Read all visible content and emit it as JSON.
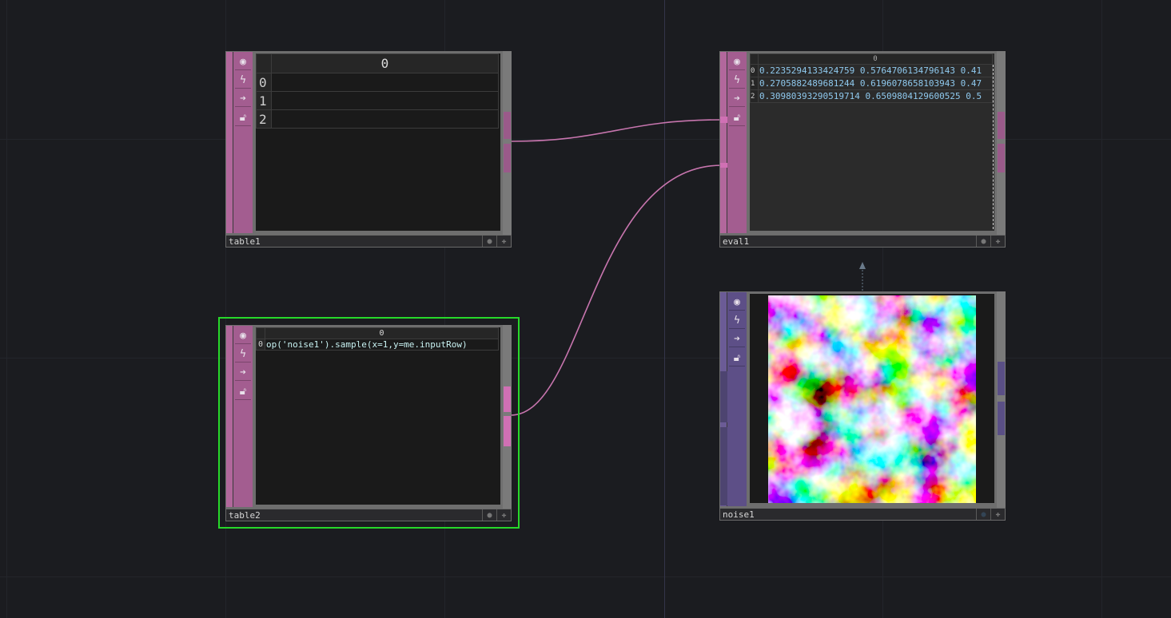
{
  "colors": {
    "background": "#1b1c20",
    "dat_accent": "#b2679c",
    "top_accent": "#6b5b96",
    "wire": "#c775ae",
    "selected_outline": "#27d82a"
  },
  "icons": [
    "viewer-toggle-icon",
    "cook-icon",
    "export-icon",
    "lock-icon",
    "bypass-flag-icon",
    "display-flag-icon"
  ],
  "nodes": {
    "table1": {
      "name": "table1",
      "col_header": "0",
      "rows": [
        {
          "index": "0",
          "value": ""
        },
        {
          "index": "1",
          "value": ""
        },
        {
          "index": "2",
          "value": ""
        }
      ]
    },
    "table2": {
      "name": "table2",
      "col_header": "0",
      "rows": [
        {
          "index": "0",
          "value": "op('noise1').sample(x=1,y=me.inputRow)"
        }
      ]
    },
    "eval1": {
      "name": "eval1",
      "col_header": "0",
      "rows": [
        {
          "index": "0",
          "value": "0.2235294133424759 0.5764706134796143 0.41"
        },
        {
          "index": "1",
          "value": "0.2705882489681244 0.6196078658103943 0.47"
        },
        {
          "index": "2",
          "value": "0.30980393290519714 0.6509804129600525 0.5"
        }
      ]
    },
    "noise1": {
      "name": "noise1"
    }
  }
}
